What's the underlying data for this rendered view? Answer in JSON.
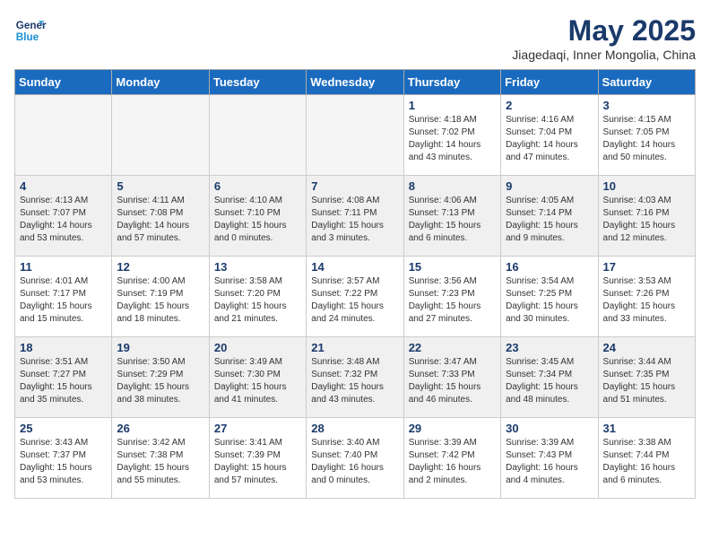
{
  "header": {
    "logo_line1": "General",
    "logo_line2": "Blue",
    "month_title": "May 2025",
    "location": "Jiagedaqi, Inner Mongolia, China"
  },
  "weekdays": [
    "Sunday",
    "Monday",
    "Tuesday",
    "Wednesday",
    "Thursday",
    "Friday",
    "Saturday"
  ],
  "weeks": [
    [
      {
        "day": "",
        "empty": true
      },
      {
        "day": "",
        "empty": true
      },
      {
        "day": "",
        "empty": true
      },
      {
        "day": "",
        "empty": true
      },
      {
        "day": "1",
        "info": "Sunrise: 4:18 AM\nSunset: 7:02 PM\nDaylight: 14 hours\nand 43 minutes."
      },
      {
        "day": "2",
        "info": "Sunrise: 4:16 AM\nSunset: 7:04 PM\nDaylight: 14 hours\nand 47 minutes."
      },
      {
        "day": "3",
        "info": "Sunrise: 4:15 AM\nSunset: 7:05 PM\nDaylight: 14 hours\nand 50 minutes."
      }
    ],
    [
      {
        "day": "4",
        "info": "Sunrise: 4:13 AM\nSunset: 7:07 PM\nDaylight: 14 hours\nand 53 minutes.",
        "shaded": true
      },
      {
        "day": "5",
        "info": "Sunrise: 4:11 AM\nSunset: 7:08 PM\nDaylight: 14 hours\nand 57 minutes.",
        "shaded": true
      },
      {
        "day": "6",
        "info": "Sunrise: 4:10 AM\nSunset: 7:10 PM\nDaylight: 15 hours\nand 0 minutes.",
        "shaded": true
      },
      {
        "day": "7",
        "info": "Sunrise: 4:08 AM\nSunset: 7:11 PM\nDaylight: 15 hours\nand 3 minutes.",
        "shaded": true
      },
      {
        "day": "8",
        "info": "Sunrise: 4:06 AM\nSunset: 7:13 PM\nDaylight: 15 hours\nand 6 minutes.",
        "shaded": true
      },
      {
        "day": "9",
        "info": "Sunrise: 4:05 AM\nSunset: 7:14 PM\nDaylight: 15 hours\nand 9 minutes.",
        "shaded": true
      },
      {
        "day": "10",
        "info": "Sunrise: 4:03 AM\nSunset: 7:16 PM\nDaylight: 15 hours\nand 12 minutes.",
        "shaded": true
      }
    ],
    [
      {
        "day": "11",
        "info": "Sunrise: 4:01 AM\nSunset: 7:17 PM\nDaylight: 15 hours\nand 15 minutes."
      },
      {
        "day": "12",
        "info": "Sunrise: 4:00 AM\nSunset: 7:19 PM\nDaylight: 15 hours\nand 18 minutes."
      },
      {
        "day": "13",
        "info": "Sunrise: 3:58 AM\nSunset: 7:20 PM\nDaylight: 15 hours\nand 21 minutes."
      },
      {
        "day": "14",
        "info": "Sunrise: 3:57 AM\nSunset: 7:22 PM\nDaylight: 15 hours\nand 24 minutes."
      },
      {
        "day": "15",
        "info": "Sunrise: 3:56 AM\nSunset: 7:23 PM\nDaylight: 15 hours\nand 27 minutes."
      },
      {
        "day": "16",
        "info": "Sunrise: 3:54 AM\nSunset: 7:25 PM\nDaylight: 15 hours\nand 30 minutes."
      },
      {
        "day": "17",
        "info": "Sunrise: 3:53 AM\nSunset: 7:26 PM\nDaylight: 15 hours\nand 33 minutes."
      }
    ],
    [
      {
        "day": "18",
        "info": "Sunrise: 3:51 AM\nSunset: 7:27 PM\nDaylight: 15 hours\nand 35 minutes.",
        "shaded": true
      },
      {
        "day": "19",
        "info": "Sunrise: 3:50 AM\nSunset: 7:29 PM\nDaylight: 15 hours\nand 38 minutes.",
        "shaded": true
      },
      {
        "day": "20",
        "info": "Sunrise: 3:49 AM\nSunset: 7:30 PM\nDaylight: 15 hours\nand 41 minutes.",
        "shaded": true
      },
      {
        "day": "21",
        "info": "Sunrise: 3:48 AM\nSunset: 7:32 PM\nDaylight: 15 hours\nand 43 minutes.",
        "shaded": true
      },
      {
        "day": "22",
        "info": "Sunrise: 3:47 AM\nSunset: 7:33 PM\nDaylight: 15 hours\nand 46 minutes.",
        "shaded": true
      },
      {
        "day": "23",
        "info": "Sunrise: 3:45 AM\nSunset: 7:34 PM\nDaylight: 15 hours\nand 48 minutes.",
        "shaded": true
      },
      {
        "day": "24",
        "info": "Sunrise: 3:44 AM\nSunset: 7:35 PM\nDaylight: 15 hours\nand 51 minutes.",
        "shaded": true
      }
    ],
    [
      {
        "day": "25",
        "info": "Sunrise: 3:43 AM\nSunset: 7:37 PM\nDaylight: 15 hours\nand 53 minutes."
      },
      {
        "day": "26",
        "info": "Sunrise: 3:42 AM\nSunset: 7:38 PM\nDaylight: 15 hours\nand 55 minutes."
      },
      {
        "day": "27",
        "info": "Sunrise: 3:41 AM\nSunset: 7:39 PM\nDaylight: 15 hours\nand 57 minutes."
      },
      {
        "day": "28",
        "info": "Sunrise: 3:40 AM\nSunset: 7:40 PM\nDaylight: 16 hours\nand 0 minutes."
      },
      {
        "day": "29",
        "info": "Sunrise: 3:39 AM\nSunset: 7:42 PM\nDaylight: 16 hours\nand 2 minutes."
      },
      {
        "day": "30",
        "info": "Sunrise: 3:39 AM\nSunset: 7:43 PM\nDaylight: 16 hours\nand 4 minutes."
      },
      {
        "day": "31",
        "info": "Sunrise: 3:38 AM\nSunset: 7:44 PM\nDaylight: 16 hours\nand 6 minutes."
      }
    ]
  ]
}
